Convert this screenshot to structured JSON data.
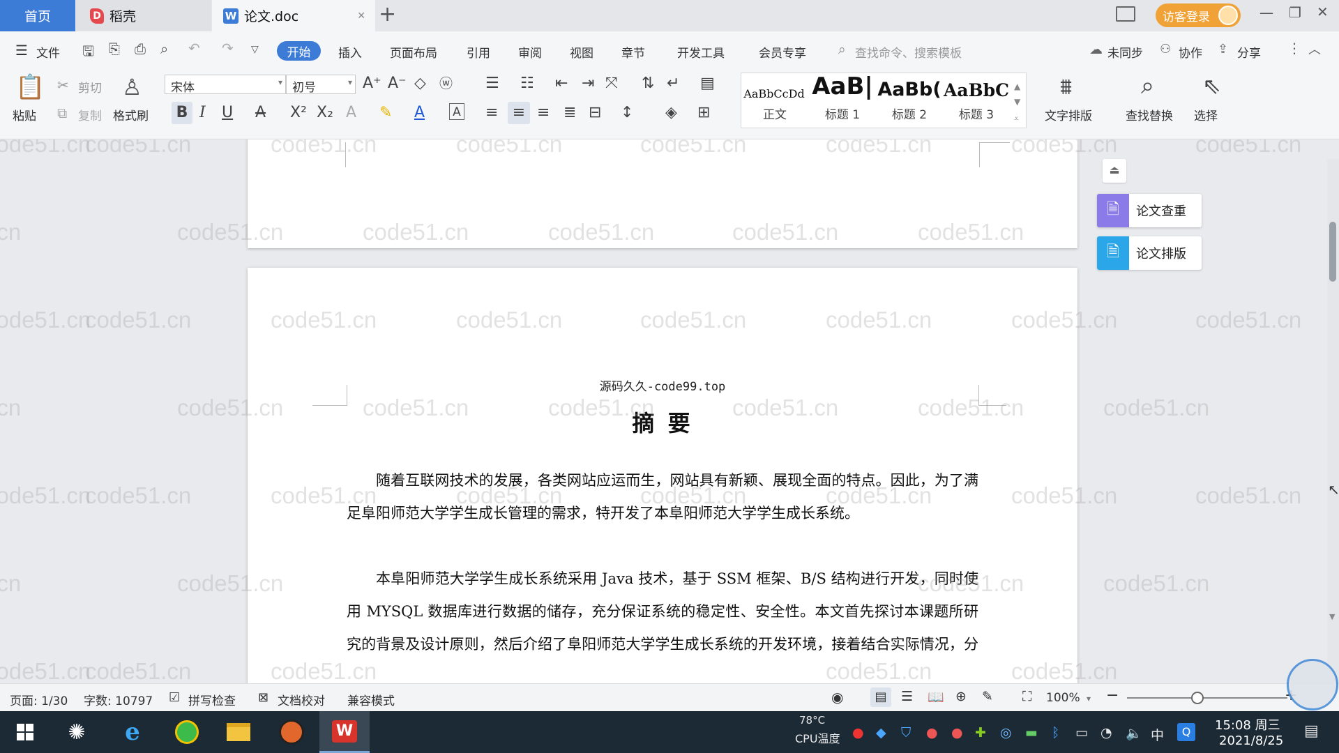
{
  "tabs": {
    "home": "首页",
    "docer": "稻壳",
    "document": "论文.doc",
    "add": "+"
  },
  "titlebar": {
    "login": "访客登录"
  },
  "menu": {
    "file": "文件",
    "items": [
      "开始",
      "插入",
      "页面布局",
      "引用",
      "审阅",
      "视图",
      "章节",
      "开发工具",
      "会员专享"
    ],
    "search_placeholder": "查找命令、搜索模板",
    "sync": "未同步",
    "collab": "协作",
    "share": "分享"
  },
  "ribbon": {
    "paste": "粘贴",
    "cut": "剪切",
    "copy": "复制",
    "format_painter": "格式刷",
    "font_name": "宋体",
    "font_size": "初号",
    "styles": [
      {
        "sample": "AaBbCcDd",
        "label": "正文"
      },
      {
        "sample": "AaB|",
        "label": "标题 1"
      },
      {
        "sample": "AaBb(",
        "label": "标题 2"
      },
      {
        "sample": "AaBbC",
        "label": "标题 3"
      }
    ],
    "text_layout": "文字排版",
    "find_replace": "查找替换",
    "select": "选择"
  },
  "document": {
    "header": "源码久久-code99.top",
    "title": "摘 要",
    "paragraphs": [
      "随着互联网技术的发展，各类网站应运而生，网站具有新颖、展现全面的特点。因此，为了满足阜阳师范大学学生成长管理的需求，特开发了本阜阳师范大学学生成长系统。",
      "本阜阳师范大学学生成长系统采用 Java 技术，基于 SSM 框架、B/S 结构进行开发，同时使用 MYSQL 数据库进行数据的储存，充分保证系统的稳定性、安全性。本文首先探讨本课题所研究的背景及设计原则，然后介绍了阜阳师范大学学生成长系统的开发环境，接着结合实际情况，分析系统的可行性以及需求，其后对系统进行设计，最后实现"
    ],
    "watermark": "code51.cn"
  },
  "side_panel": {
    "check": "论文查重",
    "format": "论文排版"
  },
  "status": {
    "page": "页面: 1/30",
    "words": "字数: 10797",
    "spell": "拼写检查",
    "proof": "文档校对",
    "compat": "兼容模式",
    "zoom": "100%"
  },
  "taskbar": {
    "temp": "78°C",
    "cpu": "CPU温度",
    "ime": "中",
    "time": "15:08 周三",
    "date": "2021/8/25"
  },
  "colors": {
    "accent": "#3c7bd6",
    "login": "#f0a236",
    "taskbar": "#1c2a36"
  }
}
